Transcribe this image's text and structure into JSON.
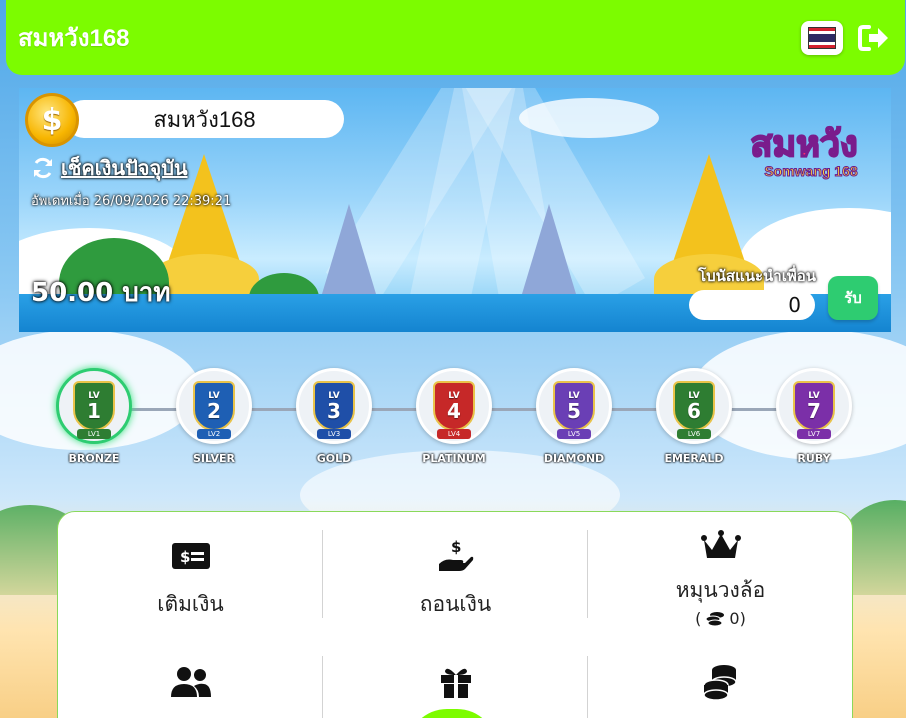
{
  "header": {
    "brand": "สมหวัง168",
    "flag_icon": "thailand-flag-icon",
    "logout_icon": "sign-out-icon"
  },
  "banner": {
    "username": "สมหวัง168",
    "check_balance_label": "เช็คเงินปัจจุบัน",
    "updated_text": "อัพเดทเมื่อ 26/09/2026 22:39:21",
    "balance_text": "50.00 บาท",
    "logo_text": "สมหวัง",
    "logo_sub": "Somwang 168",
    "referral_bonus_label": "โบนัสแนะนำเพื่อน",
    "referral_bonus_value": "0",
    "claim_label": "รับ"
  },
  "levels": [
    {
      "lv": "LV",
      "num": "1",
      "tag": "LV1",
      "name": "BRONZE",
      "color": "#2e7d32",
      "active": true
    },
    {
      "lv": "LV",
      "num": "2",
      "tag": "LV2",
      "name": "SILVER",
      "color": "#1e5fb4",
      "active": false
    },
    {
      "lv": "LV",
      "num": "3",
      "tag": "LV3",
      "name": "GOLD",
      "color": "#1f4fa8",
      "active": false
    },
    {
      "lv": "LV",
      "num": "4",
      "tag": "LV4",
      "name": "PLATINUM",
      "color": "#c62828",
      "active": false
    },
    {
      "lv": "LV",
      "num": "5",
      "tag": "LV5",
      "name": "DIAMOND",
      "color": "#6a3fb5",
      "active": false
    },
    {
      "lv": "LV",
      "num": "6",
      "tag": "LV6",
      "name": "EMERALD",
      "color": "#2e7d32",
      "active": false
    },
    {
      "lv": "LV",
      "num": "7",
      "tag": "LV7",
      "name": "RUBY",
      "color": "#7b2fa8",
      "active": false
    }
  ],
  "menu": {
    "deposit": {
      "label": "เติมเงิน",
      "icon": "money-bill-icon"
    },
    "withdraw": {
      "label": "ถอนเงิน",
      "icon": "hand-holding-dollar-icon"
    },
    "wheel": {
      "label": "หมุนวงล้อ",
      "icon": "crown-icon",
      "coins_open": "(",
      "coins": "0)",
      "coins_icon": "coins-icon"
    },
    "row2": [
      {
        "icon": "users-icon"
      },
      {
        "icon": "gift-icon"
      },
      {
        "icon": "coin-stack-icon"
      }
    ]
  }
}
